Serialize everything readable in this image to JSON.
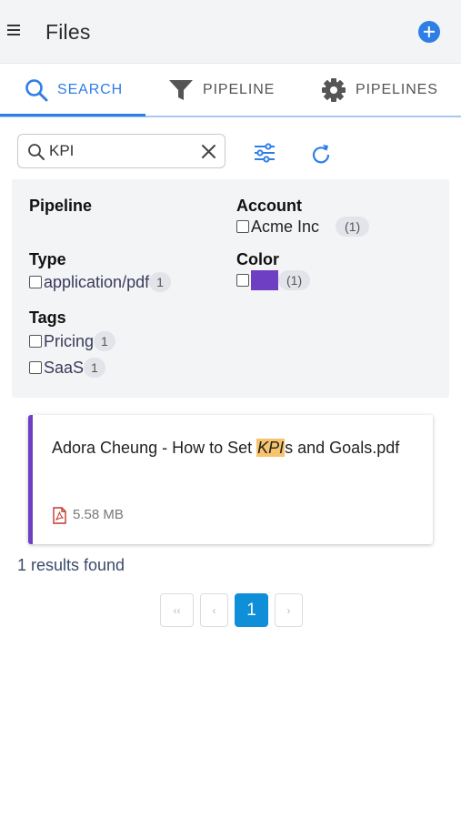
{
  "app": {
    "title": "Files",
    "menu_icon": "hamburger-menu-icon",
    "add_icon": "plus-circle-icon",
    "accent": "#2f7ee8"
  },
  "tabs": [
    {
      "label": "SEARCH",
      "icon": "search-icon",
      "active": true
    },
    {
      "label": "PIPELINE",
      "icon": "funnel-icon",
      "active": false
    },
    {
      "label": "PIPELINES",
      "icon": "gear-icon",
      "active": false
    }
  ],
  "search": {
    "value": "KPI"
  },
  "facets": {
    "pipeline": {
      "title": "Pipeline"
    },
    "account": {
      "title": "Account",
      "items": [
        {
          "label": "Acme Inc",
          "count": "(1)"
        }
      ]
    },
    "type": {
      "title": "Type",
      "items": [
        {
          "label": "application/pdf",
          "count": "1"
        }
      ]
    },
    "color": {
      "title": "Color",
      "items": [
        {
          "swatch": "#6e3fc3",
          "count": "(1)"
        }
      ]
    },
    "tags": {
      "title": "Tags",
      "items": [
        {
          "label": "Pricing",
          "count": "1"
        },
        {
          "label": "SaaS",
          "count": "1"
        }
      ]
    }
  },
  "result": {
    "title_before": "Adora Cheung - How to Set ",
    "title_highlight": "KPI",
    "title_after": "s and Goals.pdf",
    "file_icon": "pdf-file-icon",
    "size": "5.58 MB",
    "accent": "#6e3fc3"
  },
  "results_count": "1 results found",
  "pagination": {
    "first": "‹‹",
    "prev": "‹",
    "current": "1",
    "next": "›"
  }
}
